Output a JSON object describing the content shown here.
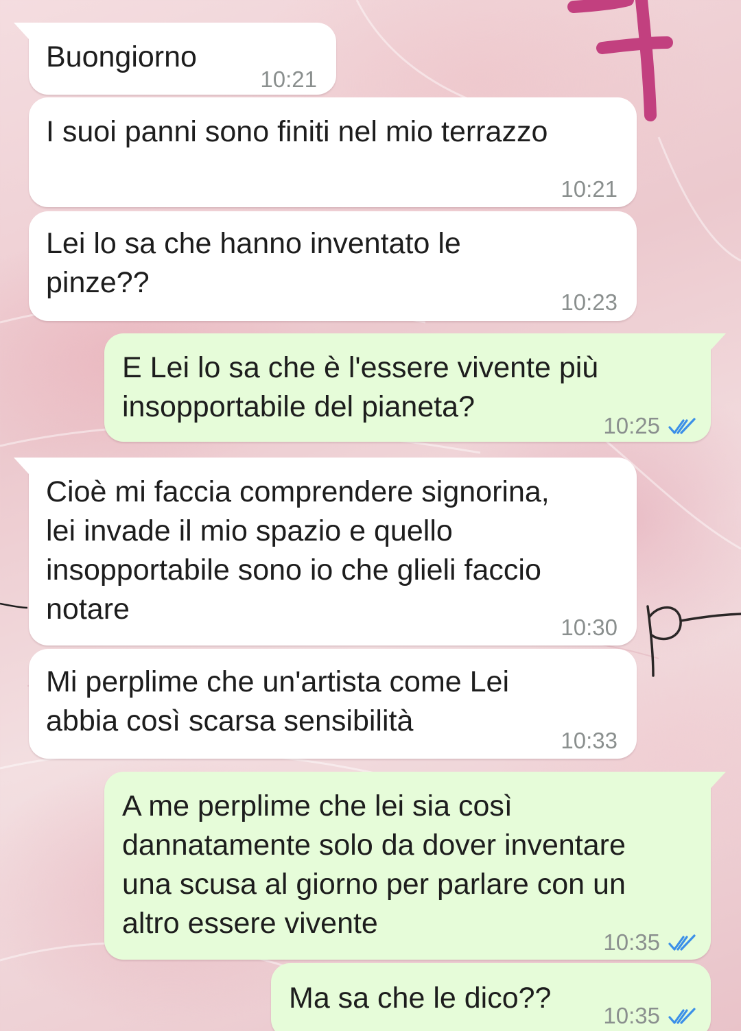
{
  "theme": {
    "incoming_bg": "#ffffff",
    "outgoing_bg": "#e6fcd9",
    "read_ticks_color": "#3b8fe8",
    "timestamp_color": "#8a8f8e"
  },
  "messages": [
    {
      "direction": "incoming",
      "text": "Buongiorno",
      "time": "10:21"
    },
    {
      "direction": "incoming",
      "text": "I suoi panni sono finiti nel mio terrazzo",
      "time": "10:21"
    },
    {
      "direction": "incoming",
      "text": "Lei lo sa che hanno inventato le\npinze??",
      "time": "10:23"
    },
    {
      "direction": "outgoing",
      "text": "E Lei lo sa che è l'essere vivente più\ninsopportabile del pianeta?",
      "time": "10:25",
      "status": "read"
    },
    {
      "direction": "incoming",
      "text": "Cioè mi faccia comprendere signorina,\nlei invade il mio spazio e quello\ninsopportabile sono io che glieli faccio\nnotare",
      "time": "10:30"
    },
    {
      "direction": "incoming",
      "text": "Mi perplime che un'artista come Lei\nabbia così scarsa sensibilità",
      "time": "10:33"
    },
    {
      "direction": "outgoing",
      "text": "A me perplime che lei sia così\ndannatamente solo da dover inventare\nuna scusa al giorno per parlare con un\naltro essere vivente",
      "time": "10:35",
      "status": "read"
    },
    {
      "direction": "outgoing",
      "text": "Ma sa che le dico??",
      "time": "10:35",
      "status": "read"
    }
  ],
  "wallpaper": {
    "drawing_color": "#c2407f",
    "icons": [
      "pink-cross-drawing",
      "script-letter-p"
    ]
  }
}
